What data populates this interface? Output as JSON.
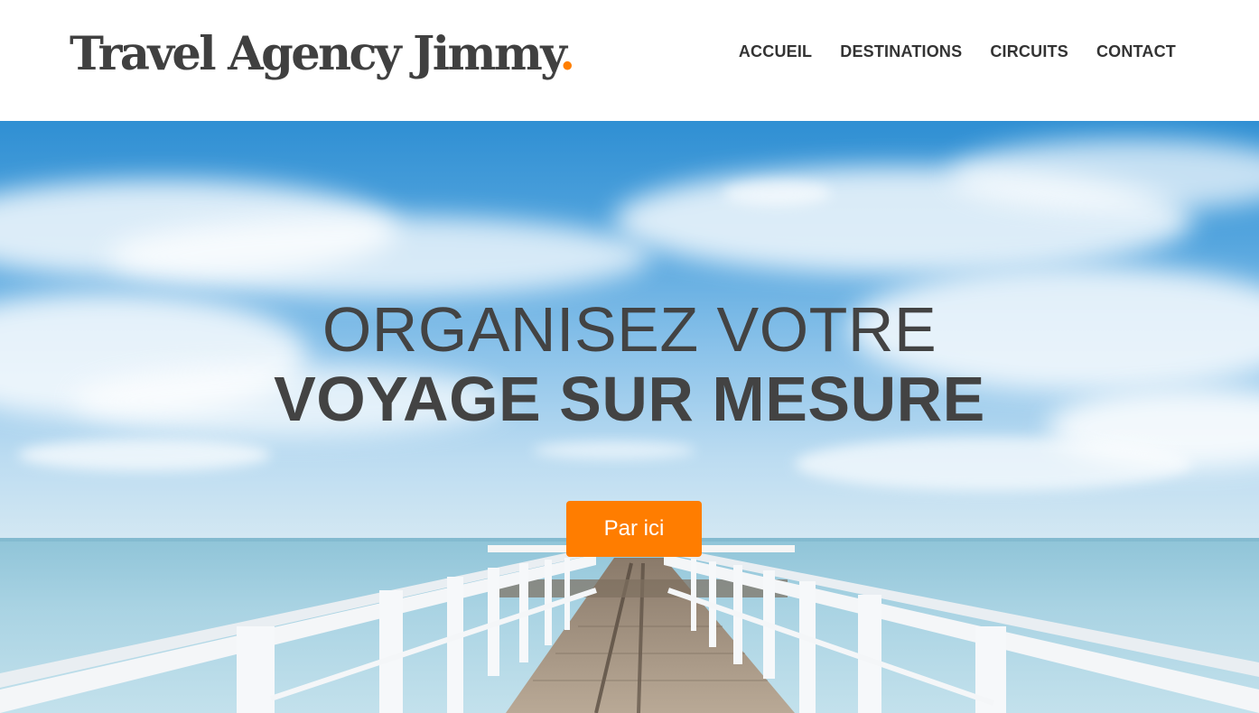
{
  "header": {
    "logo_text": "Travel Agency Jimmy",
    "logo_dot": ".",
    "nav": [
      "ACCUEIL",
      "DESTINATIONS",
      "CIRCUITS",
      "CONTACT"
    ]
  },
  "hero": {
    "title_line1": "ORGANISEZ VOTRE",
    "title_line2": "VOYAGE SUR MESURE",
    "cta_label": "Par ici",
    "background_image": "pier-over-sea-icon"
  },
  "colors": {
    "accent": "#ff7d00",
    "text_dark": "#434343",
    "header_bg": "#ffffff"
  }
}
